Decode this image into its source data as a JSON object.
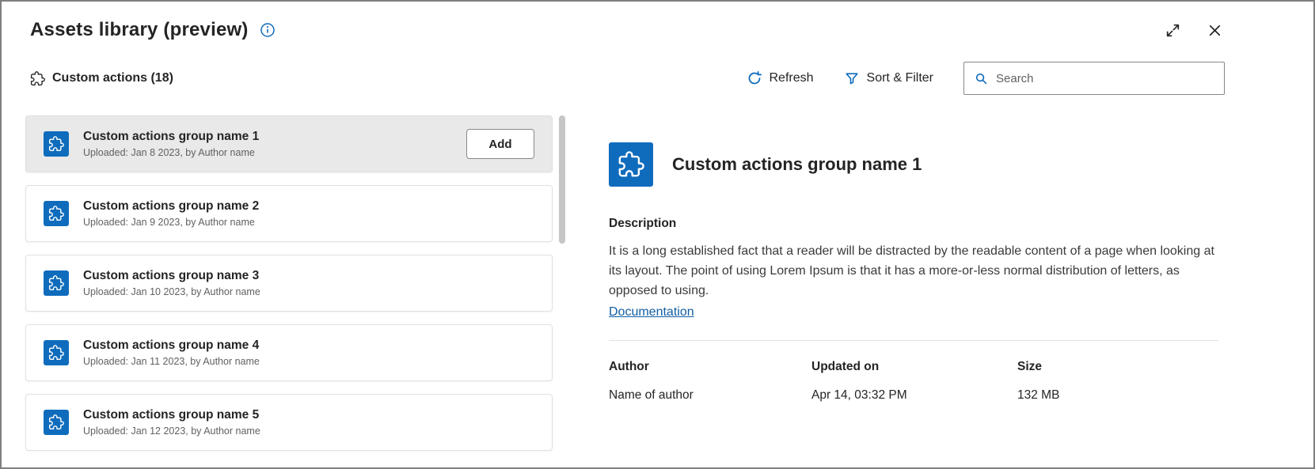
{
  "colors": {
    "accent": "#0f6cbd",
    "selected_card_bg": "#e9e9e9",
    "link": "#115ea3"
  },
  "window": {
    "title": "Assets library (preview)"
  },
  "toolbar": {
    "section_label": "Custom actions (18)",
    "refresh_label": "Refresh",
    "sort_filter_label": "Sort & Filter",
    "search_placeholder": "Search"
  },
  "list": {
    "items": [
      {
        "title": "Custom actions group name 1",
        "subtitle": "Uploaded: Jan 8 2023, by Author name",
        "add_label": "Add"
      },
      {
        "title": "Custom actions group name 2",
        "subtitle": "Uploaded: Jan 9 2023, by Author name"
      },
      {
        "title": "Custom actions group name 3",
        "subtitle": "Uploaded: Jan 10 2023, by Author name"
      },
      {
        "title": "Custom actions group name 4",
        "subtitle": "Uploaded: Jan 11 2023, by Author name"
      },
      {
        "title": "Custom actions group name 5",
        "subtitle": "Uploaded: Jan 12 2023, by Author name"
      }
    ]
  },
  "detail": {
    "title": "Custom actions group name 1",
    "description_label": "Description",
    "description_text": "It is a long established fact that a reader will be distracted by the readable content of a page when looking at its layout. The point of using Lorem Ipsum is that it has a more-or-less normal distribution of letters, as opposed to using.",
    "link_label": "Documentation",
    "meta": [
      {
        "label": "Author",
        "value": "Name of author"
      },
      {
        "label": "Updated on",
        "value": "Apr 14, 03:32 PM"
      },
      {
        "label": "Size",
        "value": "132 MB"
      }
    ]
  }
}
